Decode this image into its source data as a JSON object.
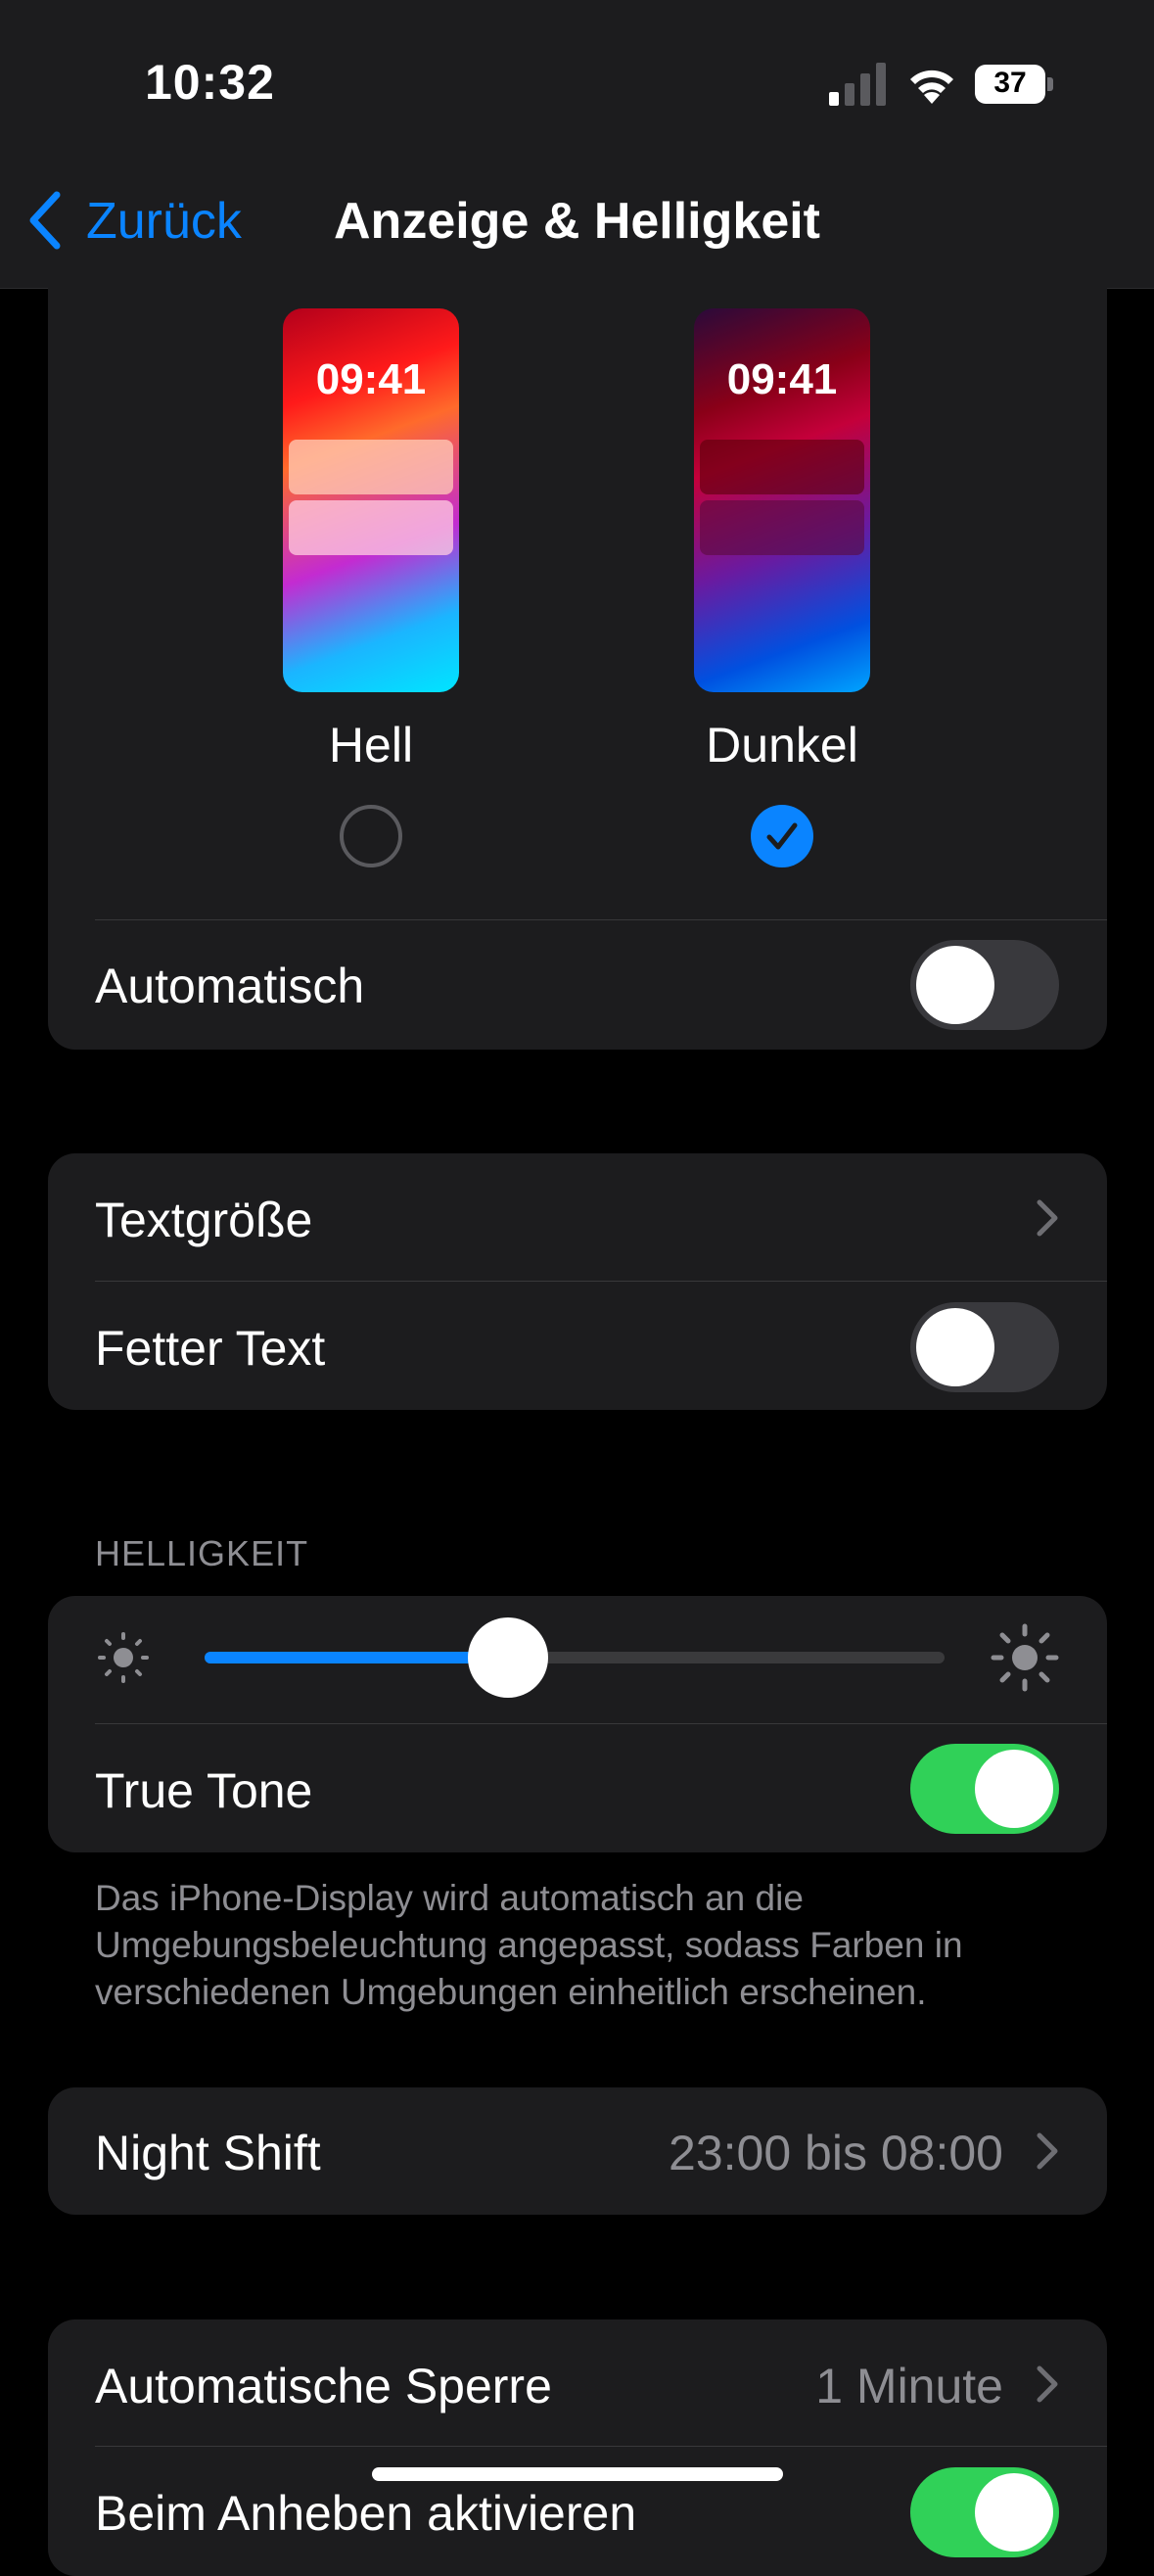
{
  "status_bar": {
    "time": "10:32",
    "battery": "37"
  },
  "nav": {
    "back_label": "Zurück",
    "title": "Anzeige & Helligkeit"
  },
  "appearance": {
    "light": {
      "label": "Hell",
      "preview_time": "09:41",
      "selected": false
    },
    "dark": {
      "label": "Dunkel",
      "preview_time": "09:41",
      "selected": true
    },
    "automatic": {
      "label": "Automatisch",
      "on": false
    }
  },
  "text_group": {
    "text_size": {
      "label": "Textgröße"
    },
    "bold_text": {
      "label": "Fetter Text",
      "on": false
    }
  },
  "brightness": {
    "header": "HELLIGKEIT",
    "level": 0.41,
    "true_tone": {
      "label": "True Tone",
      "on": true
    },
    "footnote": "Das iPhone-Display wird automatisch an die Umgebungsbeleuchtung angepasst, sodass Farben in verschiedenen Umgebungen einheitlich erscheinen."
  },
  "night_shift": {
    "label": "Night Shift",
    "value": "23:00 bis 08:00"
  },
  "lock_group": {
    "auto_lock": {
      "label": "Automatische Sperre",
      "value": "1 Minute"
    },
    "raise_to_wake": {
      "label": "Beim Anheben aktivieren",
      "on": true
    }
  },
  "colors": {
    "accent": "#0a84ff",
    "switch_on": "#30d158",
    "card": "#1c1c1e"
  }
}
